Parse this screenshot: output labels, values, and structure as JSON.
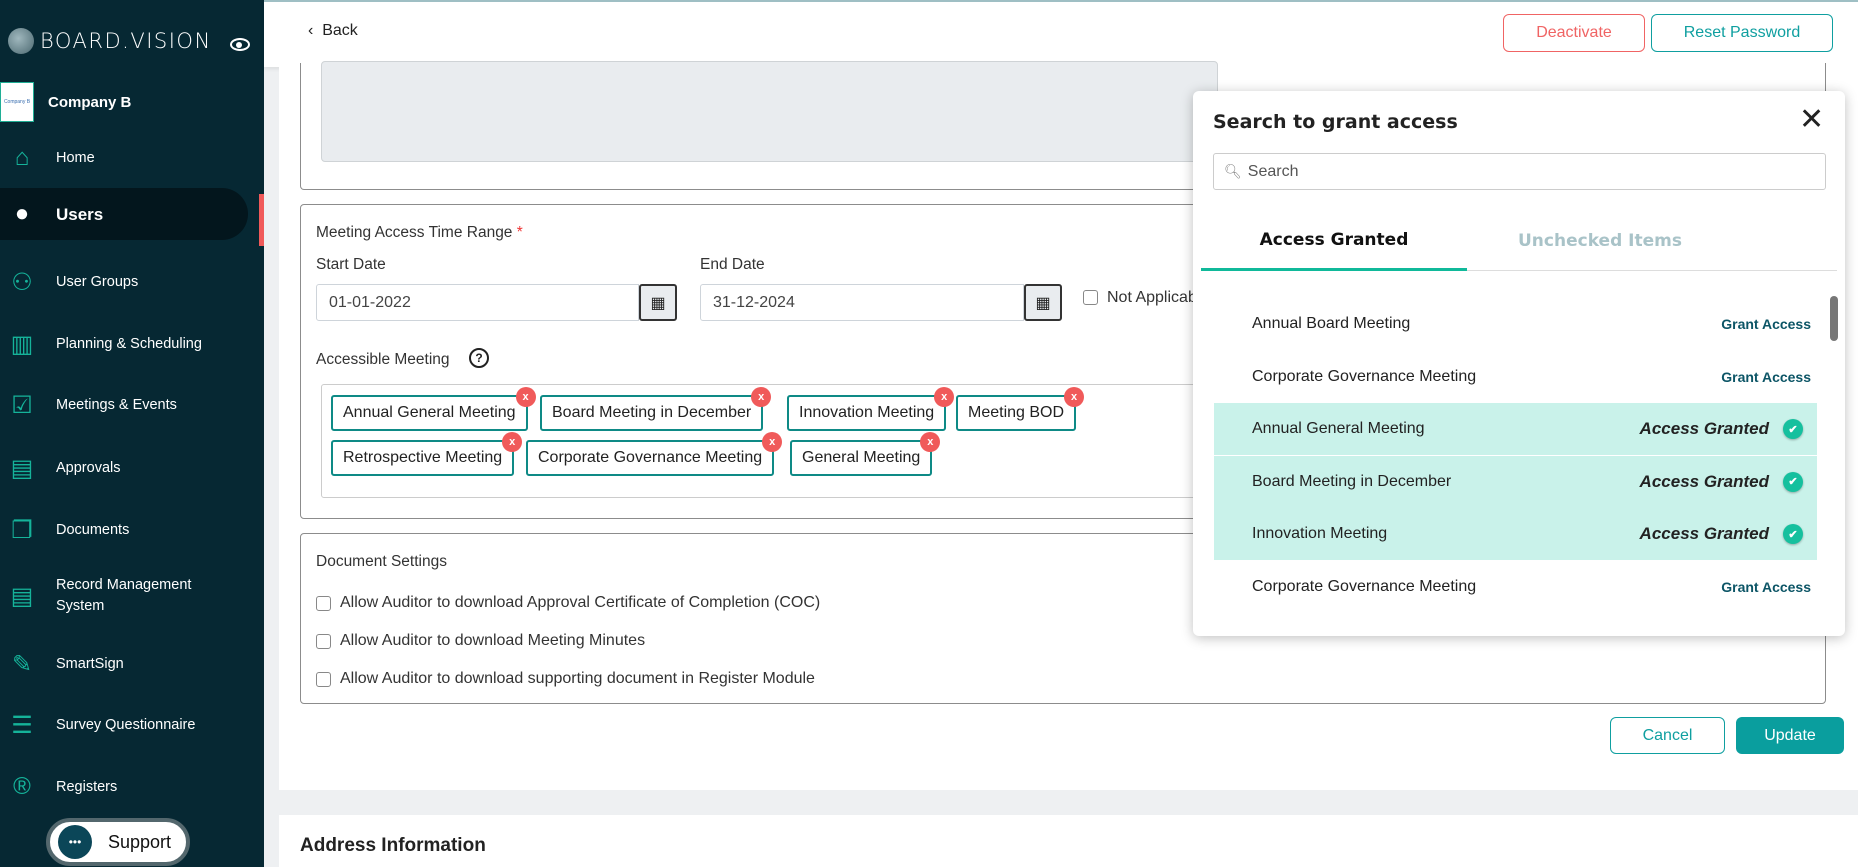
{
  "sidebar": {
    "brand": "BOARD.VISION",
    "company": {
      "logo_text": "Company B",
      "name": "Company B"
    },
    "items": [
      {
        "label": "Home",
        "icon": "home-icon"
      },
      {
        "label": "Users",
        "icon": "user-icon",
        "active": true
      },
      {
        "label": "User Groups",
        "icon": "user-groups-icon"
      },
      {
        "label": "Planning & Scheduling",
        "icon": "bar-chart-icon"
      },
      {
        "label": "Meetings & Events",
        "icon": "calendar-check-icon"
      },
      {
        "label": "Approvals",
        "icon": "approval-doc-icon"
      },
      {
        "label": "Documents",
        "icon": "documents-icon"
      },
      {
        "label": "Record Management System",
        "icon": "record-icon"
      },
      {
        "label": "SmartSign",
        "icon": "pen-signature-icon"
      },
      {
        "label": "Survey Questionnaire",
        "icon": "survey-icon"
      },
      {
        "label": "Registers",
        "icon": "registered-icon"
      }
    ],
    "support": "Support"
  },
  "header": {
    "back": "Back",
    "deactivate": "Deactivate",
    "reset_password": "Reset Password"
  },
  "form": {
    "time_range_label": "Meeting Access Time Range",
    "required_mark": "*",
    "start_label": "Start Date",
    "start_value": "01-01-2022",
    "end_label": "End Date",
    "end_value": "31-12-2024",
    "not_applicable": "Not Applicab",
    "accessible_label": "Accessible Meeting",
    "tags": [
      "Annual General Meeting",
      "Board Meeting in December",
      "Innovation Meeting",
      "Meeting BOD",
      "Retrospective Meeting",
      "Corporate Governance Meeting",
      "General Meeting"
    ],
    "tag_remove": "x",
    "doc_settings_label": "Document Settings",
    "doc_options": [
      "Allow Auditor to download Approval Certificate of Completion (COC)",
      "Allow Auditor to download Meeting Minutes",
      "Allow Auditor to download supporting document in Register Module"
    ],
    "cancel": "Cancel",
    "update": "Update"
  },
  "address": {
    "title": "Address Information"
  },
  "panel": {
    "title": "Search to grant access",
    "search_placeholder": "Search",
    "tabs": [
      "Access Granted",
      "Unchecked Items"
    ],
    "grant_label": "Grant Access",
    "granted_label": "Access Granted",
    "items": [
      {
        "name": "Annual Board Meeting",
        "granted": false
      },
      {
        "name": "Corporate Governance Meeting",
        "granted": false
      },
      {
        "name": "Annual General Meeting",
        "granted": true
      },
      {
        "name": "Board Meeting in December",
        "granted": true
      },
      {
        "name": "Innovation Meeting",
        "granted": true
      },
      {
        "name": "Corporate Governance Meeting",
        "granted": false
      }
    ]
  },
  "colors": {
    "sidebar": "#062833",
    "accent": "#0a9e9e",
    "danger": "#f05a5a",
    "granted_bg": "#c9f2ea"
  }
}
